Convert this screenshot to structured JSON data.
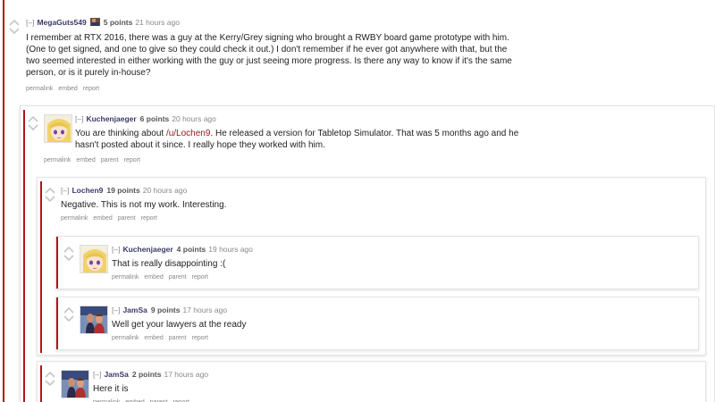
{
  "comments": [
    {
      "collapse": "[–]",
      "author": "MegaGuts549",
      "score": "5 points",
      "time": "21 hours ago",
      "body": "I remember at RTX 2016, there was a guy at the Kerry/Grey signing who brought a RWBY board game prototype with him. (One to get signed, and one to give so they could check it out.) I don't remember if he ever got anywhere with that, but the two seemed interested in either working with the guy or just seeing more progress. Is there any way to know if it's the same person, or is it purely in-house?",
      "actions": [
        "permalink",
        "embed",
        "report"
      ]
    },
    {
      "collapse": "[–]",
      "author": "Kuchenjaeger",
      "score": "6 points",
      "time": "20 hours ago",
      "body_pre": "You are thinking about ",
      "body_link": "/u/Lochen9",
      "body_post": ". He released a version for Tabletop Simulator. That was 5 months ago and he hasn't posted about it since. I really hope they worked with him.",
      "actions": [
        "permalink",
        "embed",
        "parent",
        "report"
      ]
    },
    {
      "collapse": "[–]",
      "author": "Lochen9",
      "score": "19 points",
      "time": "20 hours ago",
      "body": "Negative. This is not my work. Interesting.",
      "actions": [
        "permalink",
        "embed",
        "parent",
        "report"
      ]
    },
    {
      "collapse": "[–]",
      "author": "Kuchenjaeger",
      "score": "4 points",
      "time": "19 hours ago",
      "body": "That is really disappointing :(",
      "actions": [
        "permalink",
        "embed",
        "parent",
        "report"
      ]
    },
    {
      "collapse": "[–]",
      "author": "JamSa",
      "score": "9 points",
      "time": "17 hours ago",
      "body": "Well get your lawyers at the ready",
      "actions": [
        "permalink",
        "embed",
        "parent",
        "report"
      ]
    },
    {
      "collapse": "[–]",
      "author": "JamSa",
      "score": "2 points",
      "time": "17 hours ago",
      "body": "Here it is",
      "actions": [
        "permalink",
        "embed",
        "parent",
        "report"
      ]
    }
  ],
  "colors": {
    "thread_bar": "#b5121b",
    "link": "#8b1a1a",
    "author": "#3a3a6a",
    "meta": "#888888"
  },
  "icons": {
    "upvote": "chevron-up-icon",
    "downvote": "chevron-down-icon",
    "avatar_anime": "anime-girl-avatar",
    "avatar_photo": "couple-photo-avatar"
  }
}
